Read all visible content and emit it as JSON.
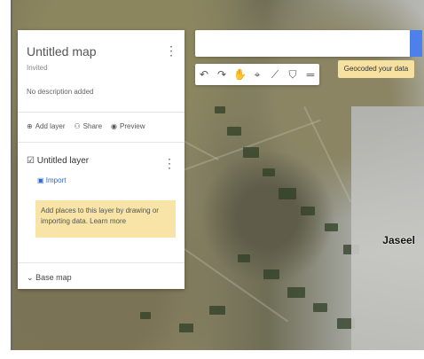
{
  "map": {
    "city_label": "Jaseel"
  },
  "panel": {
    "title": "Untitled map",
    "subtitle": "Invited",
    "description": "No description added",
    "actions": [
      {
        "icon": "add-layer-icon",
        "label": "Add layer"
      },
      {
        "icon": "share-icon",
        "label": "Share"
      },
      {
        "icon": "preview-icon",
        "label": "Preview"
      }
    ],
    "layer_name": "Untitled layer",
    "import_label": "Import",
    "note": "Add places to this layer by drawing or importing data. Learn more",
    "base_map_label": "Base map"
  },
  "toolbar": {
    "tools": [
      "undo-icon",
      "redo-icon",
      "hand-icon",
      "marker-icon",
      "line-icon",
      "filter-icon",
      "ruler-icon"
    ],
    "chip_label": "Geocoded your data"
  },
  "colors": {
    "accent_blue": "#4d80ea",
    "note_yellow": "#f7e4a6"
  }
}
